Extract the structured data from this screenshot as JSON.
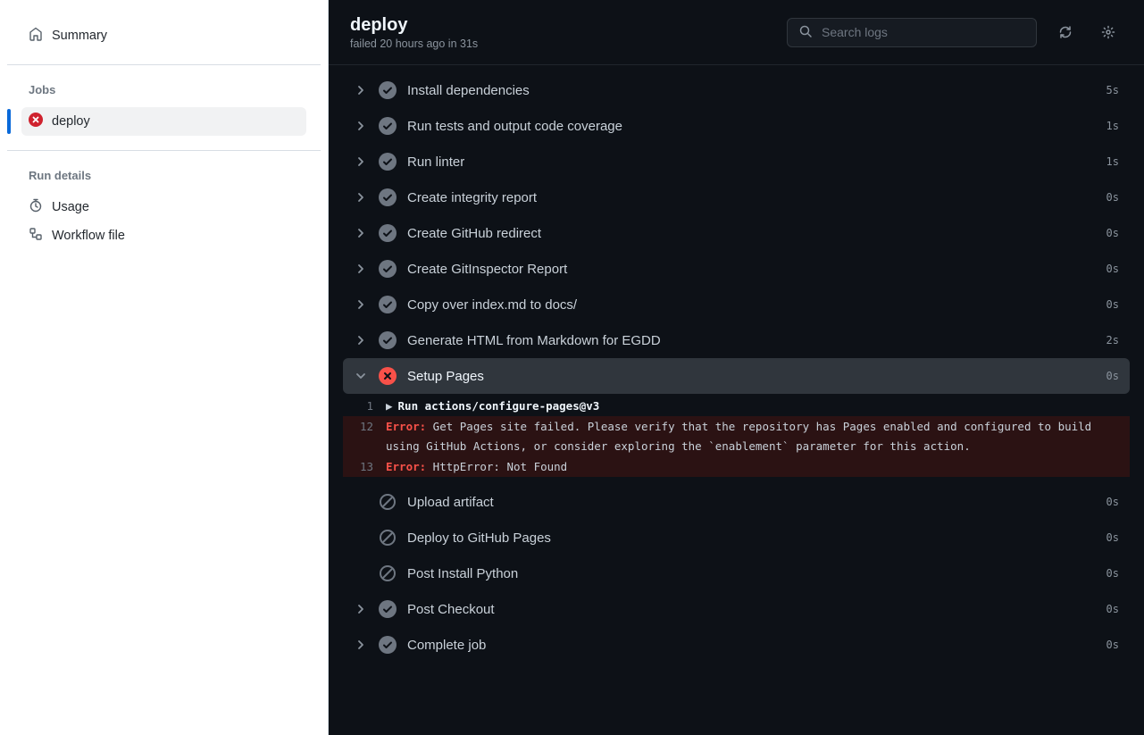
{
  "sidebar": {
    "summary_label": "Summary",
    "jobs_heading": "Jobs",
    "jobs": [
      {
        "label": "deploy",
        "status": "fail"
      }
    ],
    "details_heading": "Run details",
    "details": [
      {
        "label": "Usage",
        "icon": "stopwatch"
      },
      {
        "label": "Workflow file",
        "icon": "workflow"
      }
    ]
  },
  "header": {
    "title": "deploy",
    "subtitle": "failed 20 hours ago in 31s",
    "search_placeholder": "Search logs"
  },
  "steps": [
    {
      "label": "Install dependencies",
      "status": "success",
      "duration": "5s",
      "chevron": true
    },
    {
      "label": "Run tests and output code coverage",
      "status": "success",
      "duration": "1s",
      "chevron": true
    },
    {
      "label": "Run linter",
      "status": "success",
      "duration": "1s",
      "chevron": true
    },
    {
      "label": "Create integrity report",
      "status": "success",
      "duration": "0s",
      "chevron": true
    },
    {
      "label": "Create GitHub redirect",
      "status": "success",
      "duration": "0s",
      "chevron": true
    },
    {
      "label": "Create GitInspector Report",
      "status": "success",
      "duration": "0s",
      "chevron": true
    },
    {
      "label": "Copy over index.md to docs/",
      "status": "success",
      "duration": "0s",
      "chevron": true
    },
    {
      "label": "Generate HTML from Markdown for EGDD",
      "status": "success",
      "duration": "2s",
      "chevron": true
    },
    {
      "label": "Setup Pages",
      "status": "fail",
      "duration": "0s",
      "expanded": true,
      "chevron": true
    },
    {
      "label": "Upload artifact",
      "status": "skip",
      "duration": "0s",
      "chevron": false
    },
    {
      "label": "Deploy to GitHub Pages",
      "status": "skip",
      "duration": "0s",
      "chevron": false
    },
    {
      "label": "Post Install Python",
      "status": "skip",
      "duration": "0s",
      "chevron": false
    },
    {
      "label": "Post Checkout",
      "status": "success",
      "duration": "0s",
      "chevron": true
    },
    {
      "label": "Complete job",
      "status": "success",
      "duration": "0s",
      "chevron": true
    }
  ],
  "log": {
    "lines": [
      {
        "n": "1",
        "caret": true,
        "bold": "Run actions/configure-pages@v3",
        "error": false
      },
      {
        "n": "12",
        "err_prefix": "Error:",
        "text": " Get Pages site failed. Please verify that the repository has Pages enabled and configured to build using GitHub Actions, or consider exploring the `enablement` parameter for this action.",
        "error": true
      },
      {
        "n": "13",
        "err_prefix": "Error:",
        "text": " HttpError: Not Found",
        "error": true
      }
    ]
  }
}
